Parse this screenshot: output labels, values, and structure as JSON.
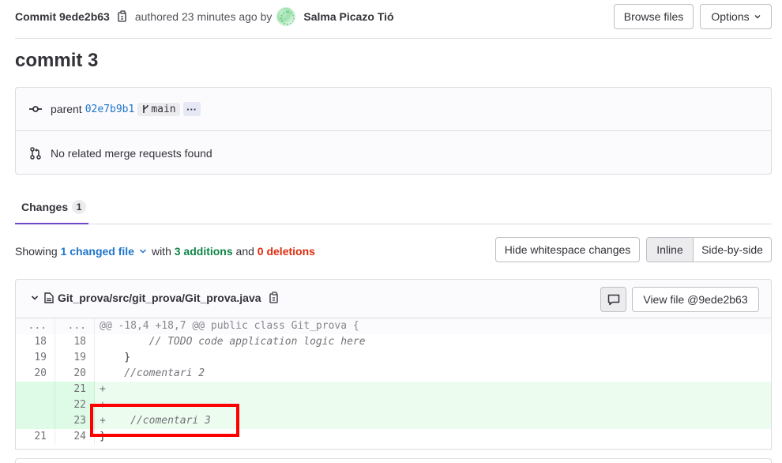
{
  "header": {
    "commit_id": "Commit 9ede2b63",
    "authored": "authored 23 minutes ago by",
    "author": "Salma Picazo Tió",
    "browse_files_label": "Browse files",
    "options_label": "Options"
  },
  "page_title": "commit 3",
  "info": {
    "parent_label": "parent",
    "parent_sha": "02e7b9b1",
    "branch": "main",
    "ellipsis": "···",
    "merge_requests_text": "No related merge requests found"
  },
  "tabs": {
    "changes_label": "Changes",
    "changes_count": "1"
  },
  "stats": {
    "showing": "Showing",
    "changed_file": "1 changed file",
    "with": "with",
    "additions": "3 additions",
    "and": "and",
    "deletions": "0 deletions",
    "hide_whitespace_label": "Hide whitespace changes",
    "inline_label": "Inline",
    "side_by_side_label": "Side-by-side"
  },
  "file": {
    "path": "Git_prova/src/git_prova/Git_prova.java",
    "view_file_label": "View file @9ede2b63",
    "lines": [
      {
        "old": "...",
        "new": "...",
        "type": "match",
        "text": "@@ -18,4 +18,7 @@ public class Git_prova {"
      },
      {
        "old": "18",
        "new": "18",
        "type": "context",
        "text": "        // TODO code application logic here",
        "comment": true
      },
      {
        "old": "19",
        "new": "19",
        "type": "context",
        "text": "    }"
      },
      {
        "old": "20",
        "new": "20",
        "type": "context",
        "text": "    //comentari 2",
        "comment": true
      },
      {
        "old": "",
        "new": "21",
        "type": "add",
        "text": "+"
      },
      {
        "old": "",
        "new": "22",
        "type": "add",
        "text": "+"
      },
      {
        "old": "",
        "new": "23",
        "type": "add",
        "text": "+    //comentari 3",
        "comment": true
      },
      {
        "old": "21",
        "new": "24",
        "type": "context",
        "text": "}"
      }
    ]
  },
  "colors": {
    "accent": "#6e49cb",
    "link": "#1f75cb",
    "addition_green": "#108548",
    "deletion_red": "#dd2b0e",
    "highlight_box": "#ff0000"
  },
  "icons": [
    "copy-icon",
    "chevron-down-icon",
    "commit-icon",
    "branch-icon",
    "merge-request-icon",
    "file-icon",
    "comment-icon"
  ]
}
